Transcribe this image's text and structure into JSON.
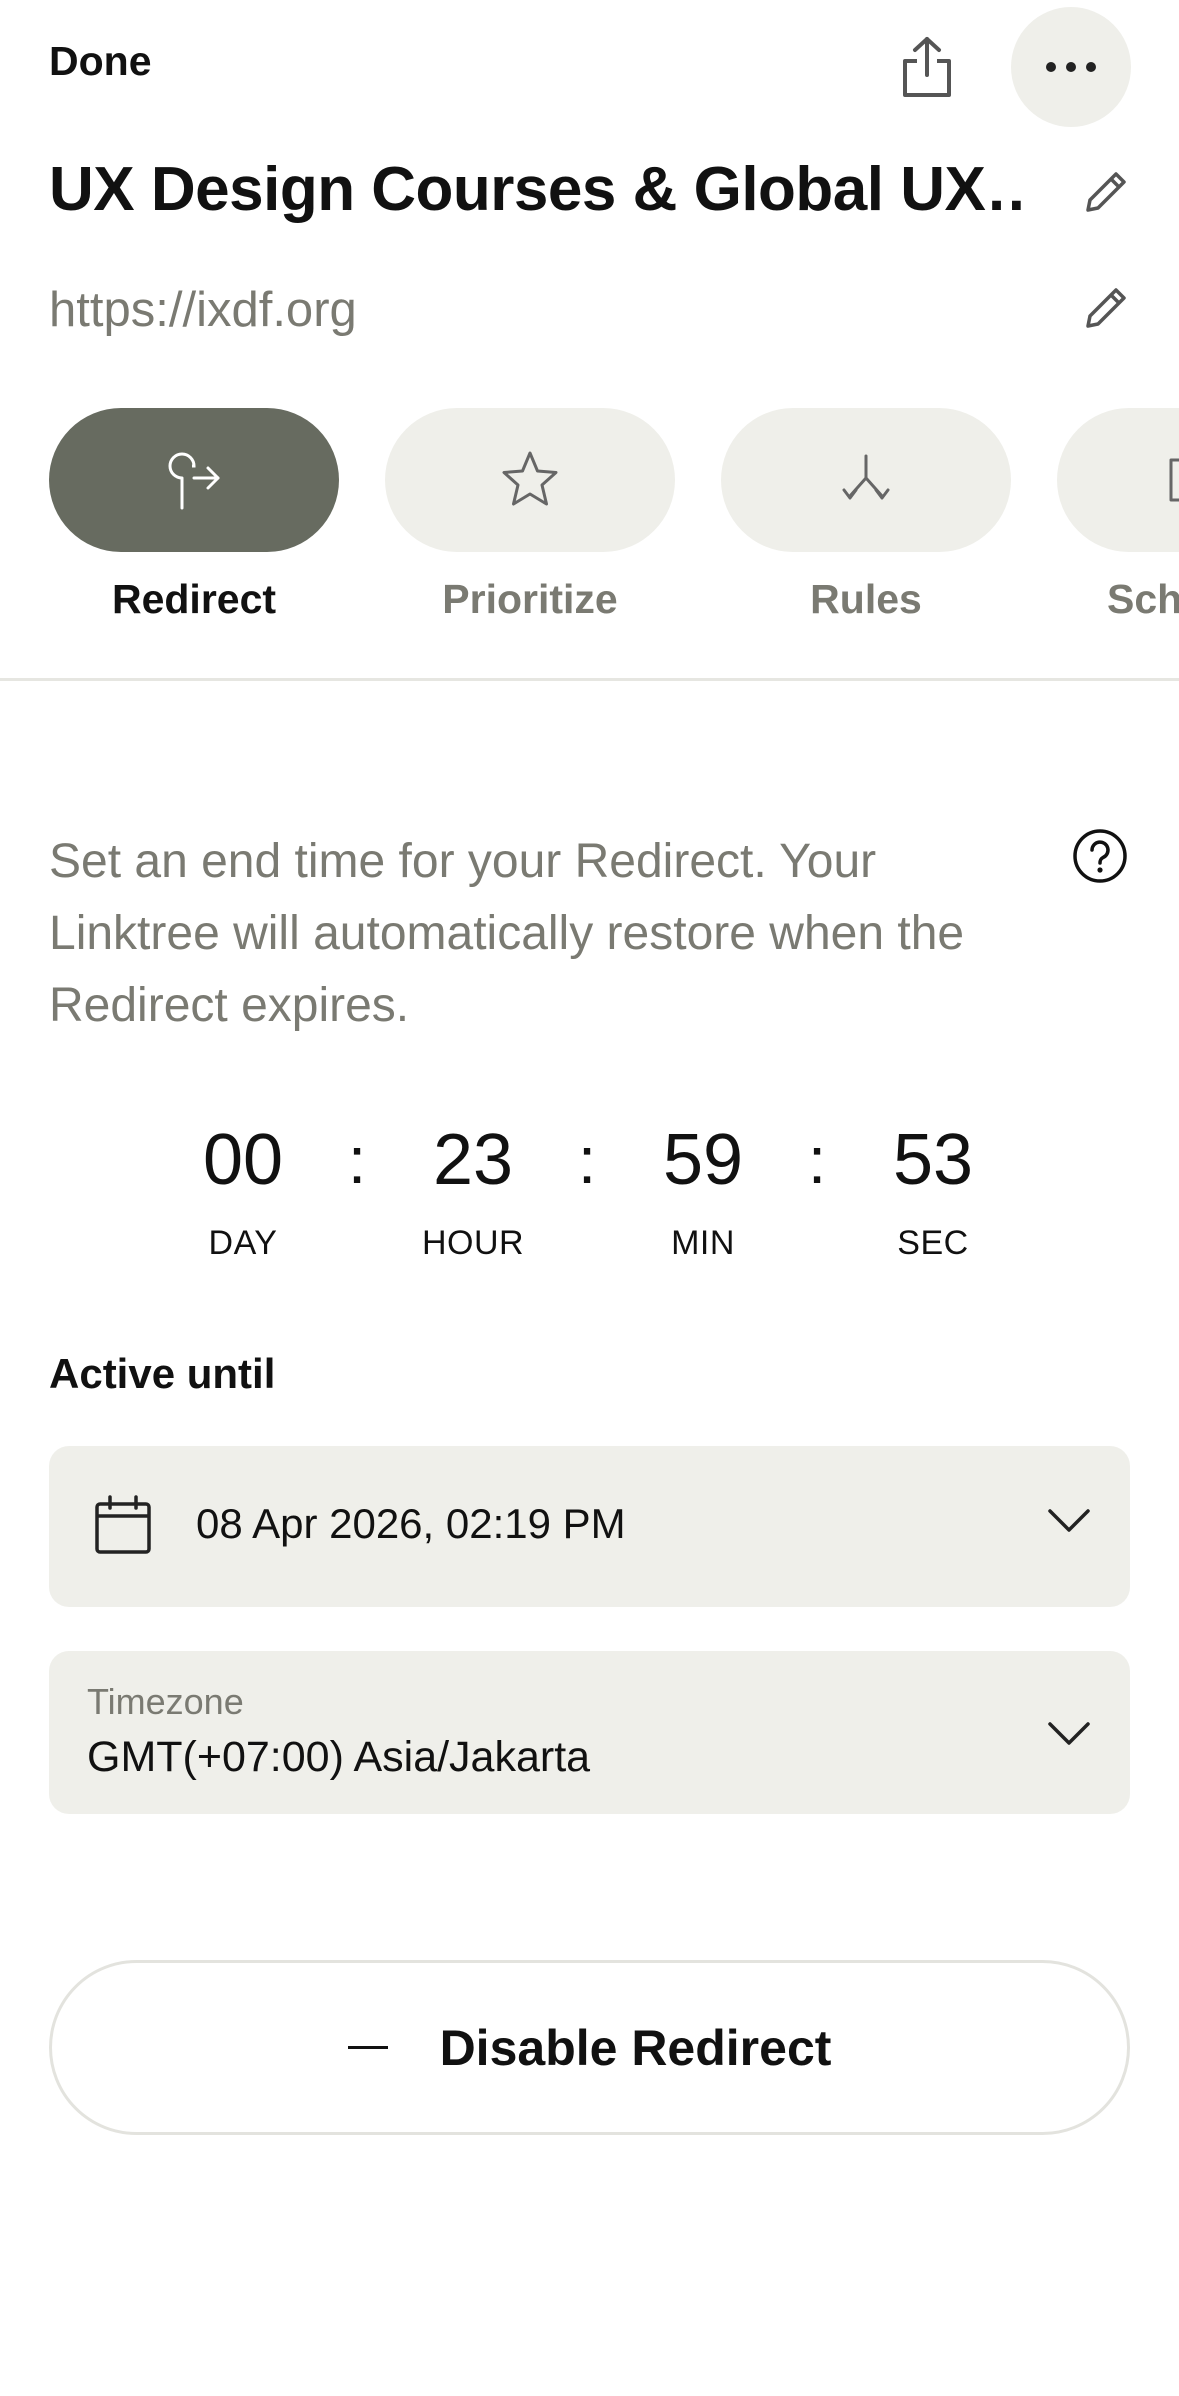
{
  "header": {
    "done_label": "Done",
    "share_icon": "share-icon",
    "more_icon": "more-icon"
  },
  "link": {
    "title": "UX Design Courses & Global UX…",
    "url": "https://ixdf.org"
  },
  "tabs": [
    {
      "label": "Redirect",
      "icon": "redirect-icon",
      "active": true
    },
    {
      "label": "Prioritize",
      "icon": "star-icon",
      "active": false
    },
    {
      "label": "Rules",
      "icon": "rules-icon",
      "active": false
    },
    {
      "label": "Sch",
      "icon": "schedule-icon",
      "active": false
    }
  ],
  "redirect": {
    "description": "Set an end time for your Redirect. Your Linktree will automatically restore when the Redirect expires.",
    "countdown": {
      "day": "00",
      "day_label": "DAY",
      "hour": "23",
      "hour_label": "HOUR",
      "min": "59",
      "min_label": "MIN",
      "sec": "53",
      "sec_label": "SEC",
      "separator": ":"
    },
    "active_until_label": "Active until",
    "date_value": "08 Apr 2026, 02:19 PM",
    "timezone_label": "Timezone",
    "timezone_value": "GMT(+07:00) Asia/Jakarta",
    "disable_label": "Disable Redirect"
  },
  "colors": {
    "accent": "#676b60",
    "surface": "#efefea",
    "muted_text": "#7a7a72"
  }
}
